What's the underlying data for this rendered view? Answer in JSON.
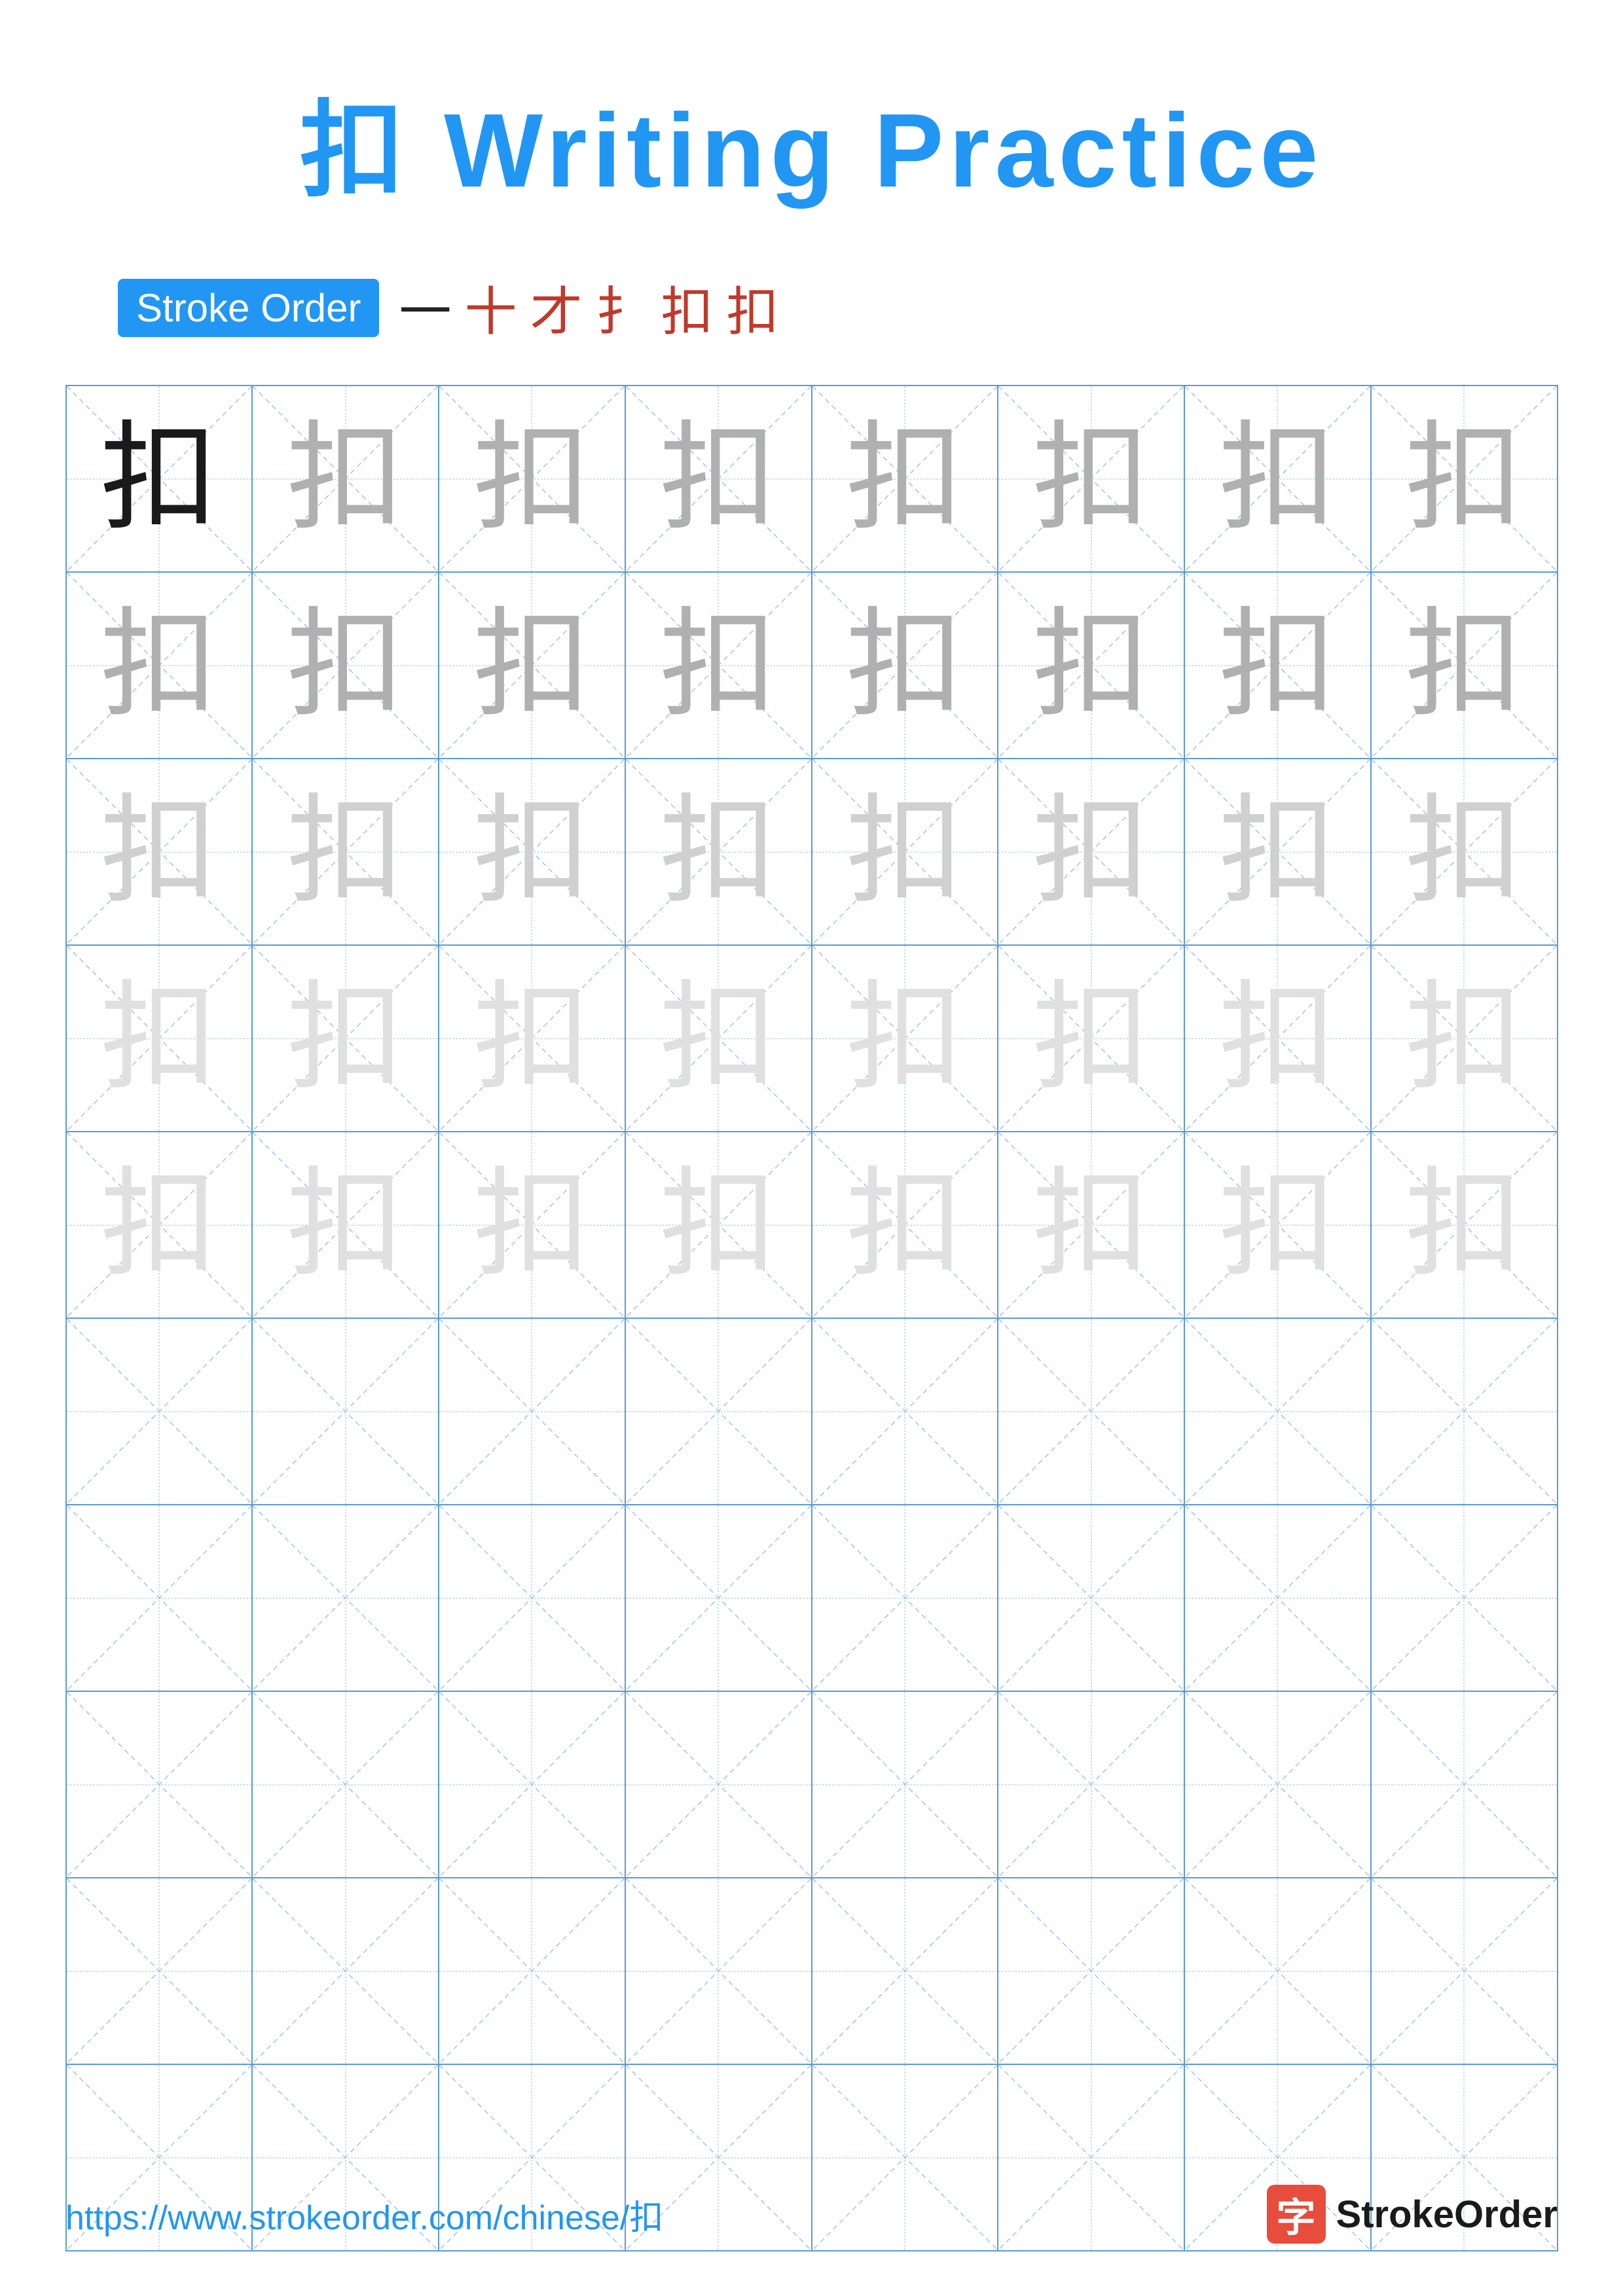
{
  "title": "扣 Writing Practice",
  "stroke_order": {
    "label": "Stroke Order",
    "strokes": [
      "一",
      "十",
      "才",
      "扌",
      "扣",
      "扣"
    ]
  },
  "character": "扣",
  "grid": {
    "rows": 10,
    "cols": 8,
    "filled_rows": 5,
    "char_levels": [
      [
        "dark",
        "medium",
        "medium",
        "medium",
        "medium",
        "medium",
        "medium",
        "medium"
      ],
      [
        "medium",
        "medium",
        "medium",
        "medium",
        "medium",
        "medium",
        "medium",
        "medium"
      ],
      [
        "light",
        "light",
        "light",
        "light",
        "light",
        "light",
        "light",
        "light"
      ],
      [
        "vlight",
        "vlight",
        "vlight",
        "vlight",
        "vlight",
        "vlight",
        "vlight",
        "vlight"
      ],
      [
        "vlight",
        "vlight",
        "vlight",
        "vlight",
        "vlight",
        "vlight",
        "vlight",
        "vlight"
      ]
    ]
  },
  "footer": {
    "url": "https://www.strokeorder.com/chinese/扣",
    "logo_char": "字",
    "logo_text": "StrokeOrder"
  }
}
